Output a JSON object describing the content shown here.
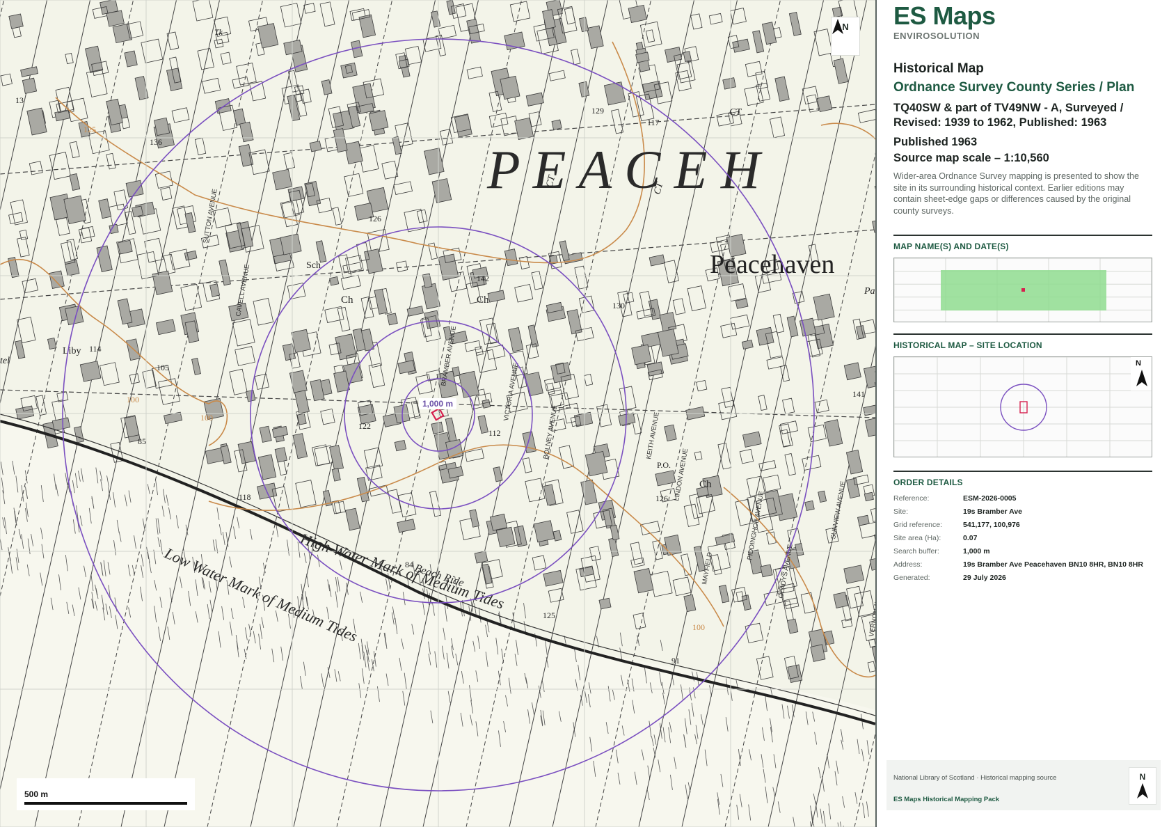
{
  "brand": {
    "name": "ES Maps",
    "subtitle": "ENVIROSOLUTION"
  },
  "map": {
    "north_label": "N",
    "buffer_label": "1,000 m",
    "scale_label": "500 m",
    "place_labels": {
      "big": "P E A C E H",
      "town": "Peacehaven",
      "school": "Sch",
      "church1": "Ch",
      "church2": "Ch",
      "church3": "Ch",
      "library": "Liby",
      "po": "P.O.",
      "ct1": "CT",
      "ct2": "CT",
      "ct3": "CT",
      "low_water": "Low Water Mark of Medium Tides",
      "high_water": "High Water Mark of Medium Tides",
      "beach": "Beach Ride",
      "tel": "tel",
      "pa": "Pa",
      "tk": "Tk"
    },
    "spot_heights": [
      "136",
      "129",
      "117",
      "126",
      "142",
      "130",
      "122",
      "112",
      "105",
      "100",
      "100",
      "85",
      "118",
      "84",
      "125",
      "126",
      "141",
      "100",
      "91",
      "13",
      "114",
      "125"
    ],
    "street_names": [
      "SUTTON AVENUE",
      "CAVELL AVENUE",
      "VICTORIA AVENUE",
      "BOLNEY AVENUE",
      "SUNVIEW AVENUE",
      "VERNON AVENUE",
      "MAYFIELD",
      "LINDON AVENUE",
      "PIDDINGHOE AVENUE",
      "GLADYS AVENUE",
      "KEITH AVENUE",
      "BRAMBER AVENUE"
    ],
    "colors": {
      "buffer": "#7a4fc0",
      "site": "#d6204e",
      "contour": "#c98a4a",
      "paper": "#f3f4e9",
      "ink": "#333333"
    }
  },
  "panel": {
    "heading": "Historical Map",
    "series": "Ordnance Survey County Series / Plan",
    "sheet": "TQ40SW & part of TV49NW - A, Surveyed / Revised: 1939 to 1962, Published: 1963",
    "published": "Published 1963",
    "source_scale": "Source map scale – 1:10,560",
    "description": "Wider-area Ordnance Survey mapping is presented to show the site in its surrounding historical context. Earlier editions may contain sheet-edge gaps or differences caused by the original county surveys.",
    "section1": "MAP NAME(S) AND DATE(S)",
    "section2": "HISTORICAL MAP – SITE LOCATION",
    "section3": "ORDER DETAILS",
    "mini_north": "N",
    "order": [
      {
        "key": "Reference:",
        "value": "ESM-2026-0005"
      },
      {
        "key": "Site:",
        "value": "19s Bramber Ave"
      },
      {
        "key": "Grid reference:",
        "value": "541,177, 100,976"
      },
      {
        "key": "Site area (Ha):",
        "value": "0.07"
      },
      {
        "key": "Search buffer:",
        "value": "1,000 m"
      },
      {
        "key": "Address:",
        "value": "19s Bramber Ave Peacehaven BN10 8HR, BN10 8HR"
      },
      {
        "key": "Generated:",
        "value": "29 July 2026"
      }
    ],
    "footer": {
      "source": "National Library of Scotland · Historical mapping source",
      "pack": "ES Maps Historical Mapping Pack",
      "north": "N"
    },
    "coverage_color": "#8fdc8f"
  }
}
